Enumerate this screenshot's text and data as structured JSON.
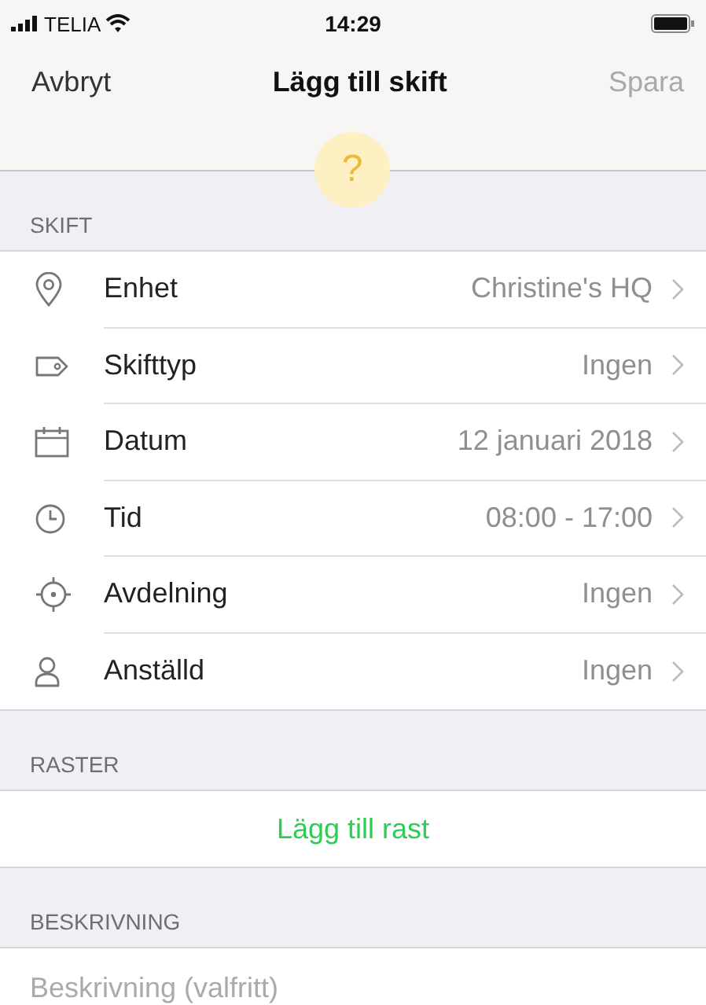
{
  "status_bar": {
    "carrier": "TELIA",
    "time": "14:29"
  },
  "nav": {
    "cancel": "Avbryt",
    "title": "Lägg till skift",
    "save": {
      "label": "Spara",
      "disabled": true
    },
    "help": "?"
  },
  "sections": [
    {
      "header": "SKIFT",
      "kind": "rows",
      "rows": [
        {
          "kind": "pin",
          "label": "Enhet",
          "value": "Christine's HQ"
        },
        {
          "kind": "tag",
          "label": "Skifttyp",
          "value": "Ingen"
        },
        {
          "kind": "calendar",
          "label": "Datum",
          "value": "12 januari 2018"
        },
        {
          "kind": "clock",
          "label": "Tid",
          "value": "08:00 - 17:00"
        },
        {
          "kind": "target",
          "label": "Avdelning",
          "value": "Ingen"
        },
        {
          "kind": "person",
          "label": "Anställd",
          "value": "Ingen"
        }
      ]
    },
    {
      "header": "RASTER",
      "kind": "action",
      "action": "Lägg till rast"
    },
    {
      "header": "BESKRIVNING",
      "kind": "field",
      "placeholder": "Beskrivning (valfritt)"
    }
  ]
}
